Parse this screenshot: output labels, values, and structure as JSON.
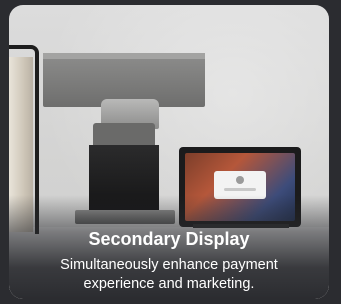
{
  "card": {
    "title": "Secondary Display",
    "description": "Simultaneously enhance payment experience and marketing."
  },
  "colors": {
    "page_background": "#2b2c30",
    "text": "#ffffff"
  }
}
